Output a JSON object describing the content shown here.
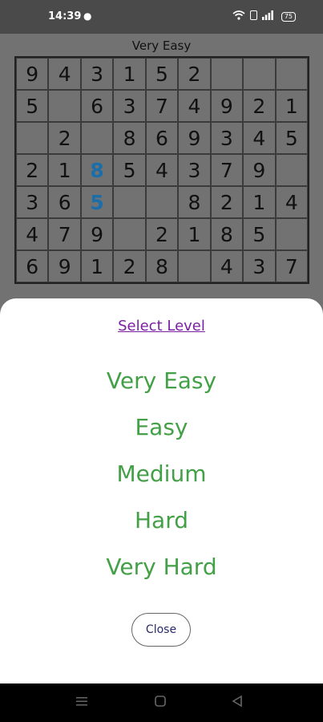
{
  "status_bar": {
    "time": "14:39",
    "battery": "75",
    "icons": [
      "notification-icon",
      "wifi-icon",
      "sim-icon",
      "signal-icon",
      "battery-icon"
    ]
  },
  "game": {
    "level_title": "Very Easy",
    "grid": [
      [
        "9",
        "4",
        "3",
        "1",
        "5",
        "2",
        "",
        "",
        ""
      ],
      [
        "5",
        "",
        "6",
        "3",
        "7",
        "4",
        "9",
        "2",
        "1"
      ],
      [
        "",
        "2",
        "",
        "8",
        "6",
        "9",
        "3",
        "4",
        "5"
      ],
      [
        "2",
        "1",
        "8",
        "5",
        "4",
        "3",
        "7",
        "9",
        ""
      ],
      [
        "3",
        "6",
        "5",
        "",
        "",
        "8",
        "2",
        "1",
        "4"
      ],
      [
        "4",
        "7",
        "9",
        "",
        "2",
        "1",
        "8",
        "5",
        ""
      ],
      [
        "6",
        "9",
        "1",
        "2",
        "8",
        "",
        "4",
        "3",
        "7"
      ]
    ],
    "user_cells": [
      [
        3,
        2
      ],
      [
        4,
        2
      ]
    ],
    "user_color": "#1b6ea8"
  },
  "dialog": {
    "title": "Select Level",
    "levels": [
      "Very Easy",
      "Easy",
      "Medium",
      "Hard",
      "Very Hard"
    ],
    "close_label": "Close",
    "level_color": "#43a047",
    "title_color": "#7b1fa2"
  },
  "nav_bar": {
    "icons": [
      "recents-icon",
      "home-icon",
      "back-icon"
    ]
  }
}
